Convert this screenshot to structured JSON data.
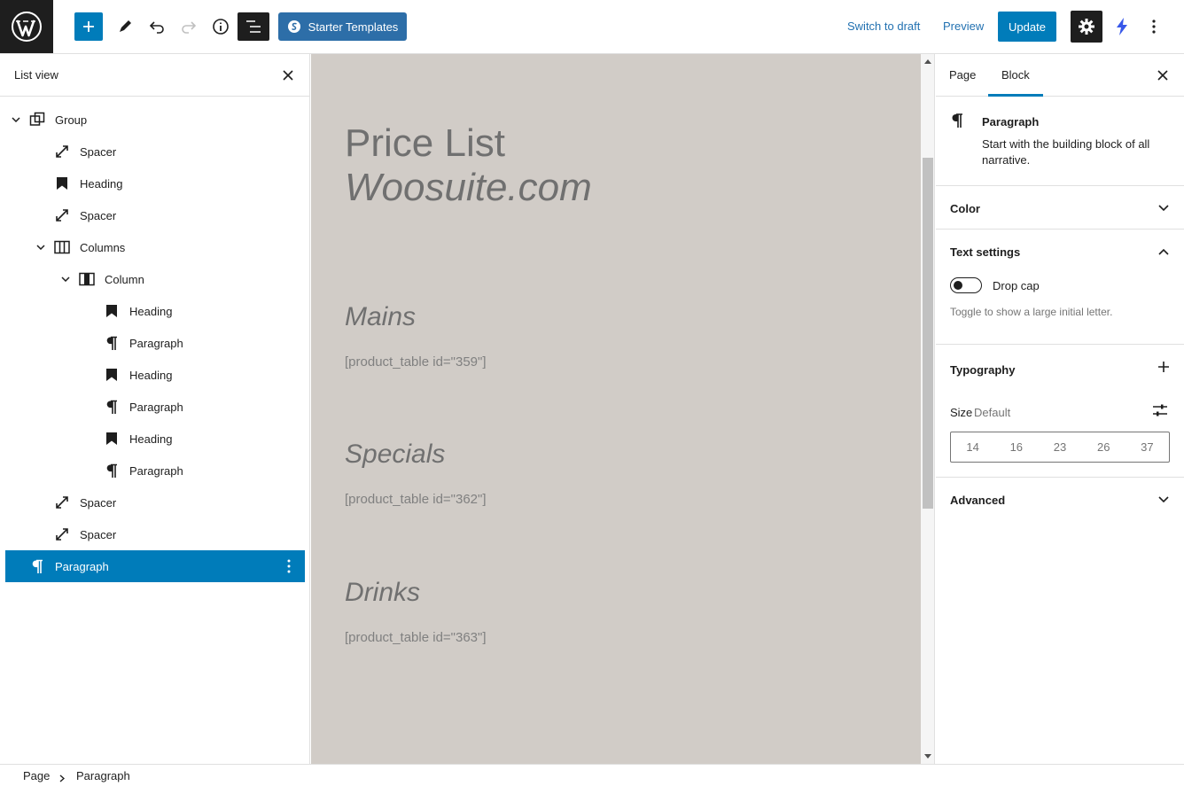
{
  "toolbar": {
    "starter_templates": "Starter Templates",
    "switch_to_draft": "Switch to draft",
    "preview": "Preview",
    "update": "Update"
  },
  "list_view": {
    "title": "List view",
    "items": [
      {
        "label": "Group",
        "icon": "group-icon",
        "depth": 0,
        "expandable": true
      },
      {
        "label": "Spacer",
        "icon": "spacer-icon",
        "depth": 1
      },
      {
        "label": "Heading",
        "icon": "heading-icon",
        "depth": 1
      },
      {
        "label": "Spacer",
        "icon": "spacer-icon",
        "depth": 1
      },
      {
        "label": "Columns",
        "icon": "columns-icon",
        "depth": 1,
        "expandable": true
      },
      {
        "label": "Column",
        "icon": "column-icon",
        "depth": 2,
        "expandable": true
      },
      {
        "label": "Heading",
        "icon": "heading-icon",
        "depth": 3
      },
      {
        "label": "Paragraph",
        "icon": "paragraph-icon",
        "depth": 3
      },
      {
        "label": "Heading",
        "icon": "heading-icon",
        "depth": 3
      },
      {
        "label": "Paragraph",
        "icon": "paragraph-icon",
        "depth": 3
      },
      {
        "label": "Heading",
        "icon": "heading-icon",
        "depth": 3
      },
      {
        "label": "Paragraph",
        "icon": "paragraph-icon",
        "depth": 3
      },
      {
        "label": "Spacer",
        "icon": "spacer-icon",
        "depth": 1
      },
      {
        "label": "Spacer",
        "icon": "spacer-icon",
        "depth": 1
      },
      {
        "label": "Paragraph",
        "icon": "paragraph-icon",
        "depth": 0,
        "selected": true
      }
    ]
  },
  "canvas": {
    "title_line1": "Price List",
    "title_line2": "Woosuite.com",
    "sections": [
      {
        "heading": "Mains",
        "shortcode": "[product_table id=\"359\"]"
      },
      {
        "heading": "Specials",
        "shortcode": "[product_table id=\"362\"]"
      },
      {
        "heading": "Drinks",
        "shortcode": "[product_table id=\"363\"]"
      }
    ]
  },
  "sidebar": {
    "tab_page": "Page",
    "tab_block": "Block",
    "block_name": "Paragraph",
    "block_desc": "Start with the building block of all narrative.",
    "color": "Color",
    "text_settings": "Text settings",
    "drop_cap": "Drop cap",
    "drop_cap_help": "Toggle to show a large initial letter.",
    "typography": "Typography",
    "size_label": "Size",
    "size_value": "Default",
    "sizes": [
      "14",
      "16",
      "23",
      "26",
      "37"
    ],
    "advanced": "Advanced"
  },
  "breadcrumb": {
    "items": [
      "Page",
      "Paragraph"
    ]
  },
  "colors": {
    "accent": "#007cba",
    "canvas_bg": "#d1ccc7"
  }
}
